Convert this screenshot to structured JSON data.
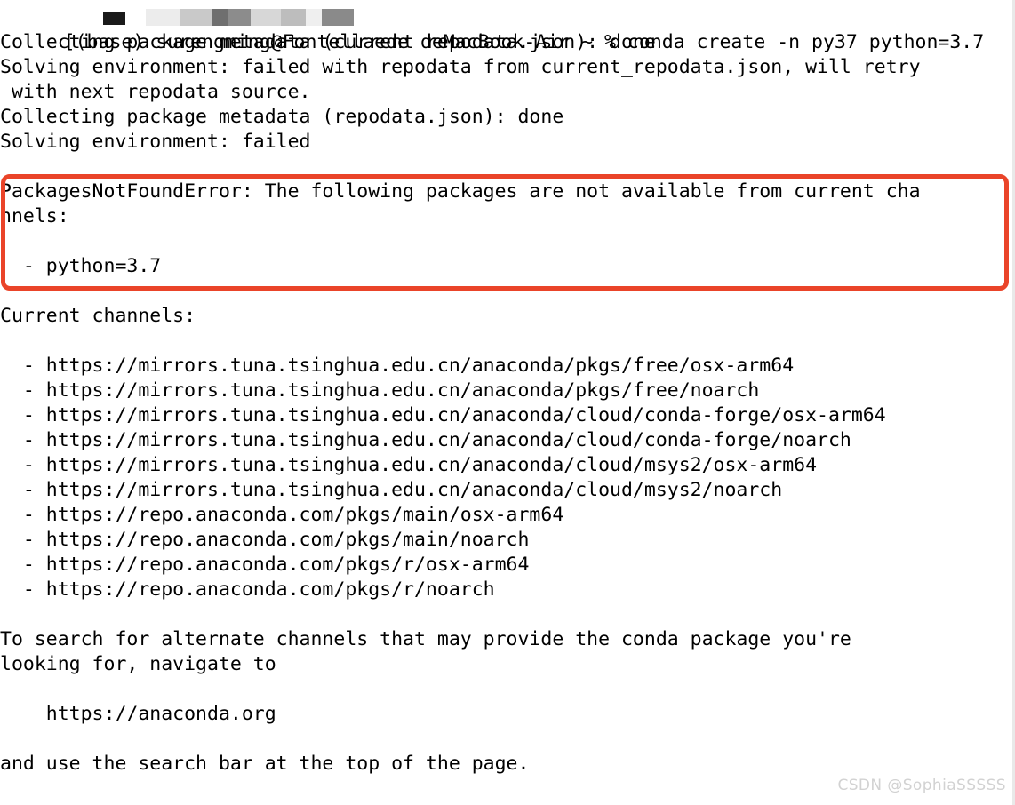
{
  "terminal": {
    "shell_prompt": {
      "env": "(base)",
      "user_host_visible_tail": "deMacBook-Air",
      "path": "~",
      "sigil": "%",
      "command": "conda create -n py37 python=3.7",
      "full_line": "[(base) surengming@Fontellaede deMacBook-Air ~ % conda create -n py37 python=3.7    ]",
      "redacted": true
    },
    "output_lines": [
      "Collecting package metadata (current_repodata.json): done",
      "Solving environment: failed with repodata from current_repodata.json, will retry",
      " with next repodata source.",
      "Collecting package metadata (repodata.json): done",
      "Solving environment: failed"
    ],
    "error_block": {
      "line1": "PackagesNotFoundError: The following packages are not available from current cha",
      "line2": "nnels:",
      "blank": "",
      "package": "  - python=3.7",
      "highlight_color": "#ea4429"
    },
    "channels_header": "Current channels:",
    "channels": [
      "  - https://mirrors.tuna.tsinghua.edu.cn/anaconda/pkgs/free/osx-arm64",
      "  - https://mirrors.tuna.tsinghua.edu.cn/anaconda/pkgs/free/noarch",
      "  - https://mirrors.tuna.tsinghua.edu.cn/anaconda/cloud/conda-forge/osx-arm64",
      "  - https://mirrors.tuna.tsinghua.edu.cn/anaconda/cloud/conda-forge/noarch",
      "  - https://mirrors.tuna.tsinghua.edu.cn/anaconda/cloud/msys2/osx-arm64",
      "  - https://mirrors.tuna.tsinghua.edu.cn/anaconda/cloud/msys2/noarch",
      "  - https://repo.anaconda.com/pkgs/main/osx-arm64",
      "  - https://repo.anaconda.com/pkgs/main/noarch",
      "  - https://repo.anaconda.com/pkgs/r/osx-arm64",
      "  - https://repo.anaconda.com/pkgs/r/noarch"
    ],
    "footer_lines": [
      "To search for alternate channels that may provide the conda package you're",
      "looking for, navigate to",
      "",
      "    https://anaconda.org",
      "",
      "and use the search bar at the top of the page."
    ]
  },
  "watermark": {
    "text": "CSDN @SophiaSSSSS"
  }
}
